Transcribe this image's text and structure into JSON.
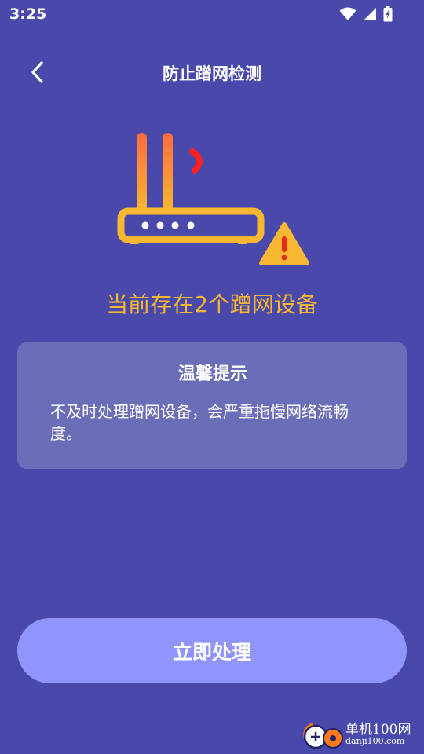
{
  "status_bar": {
    "time": "3:25",
    "icons": [
      "wifi-icon",
      "signal-icon",
      "battery-charging-icon"
    ]
  },
  "header": {
    "back_icon": "chevron-left-icon",
    "title": "防止蹭网检测"
  },
  "illustration": {
    "icons": [
      "router-icon",
      "warning-icon"
    ],
    "colors": {
      "router": "#f7b731",
      "antenna_top": "#ff6b3d",
      "signal": "#ff2020",
      "warning": "#f7b731"
    }
  },
  "result": {
    "text": "当前存在2个蹭网设备"
  },
  "tips": {
    "title": "温馨提示",
    "text": "不及时处理蹭网设备，会严重拖慢网络流畅度。"
  },
  "action": {
    "label": "立即处理"
  },
  "watermark": {
    "name": "单机100网",
    "url": "danji100.com"
  },
  "colors": {
    "background": "#4849ab",
    "card": "#6a6db8",
    "button": "#9095fb",
    "highlight": "#f7b731"
  }
}
